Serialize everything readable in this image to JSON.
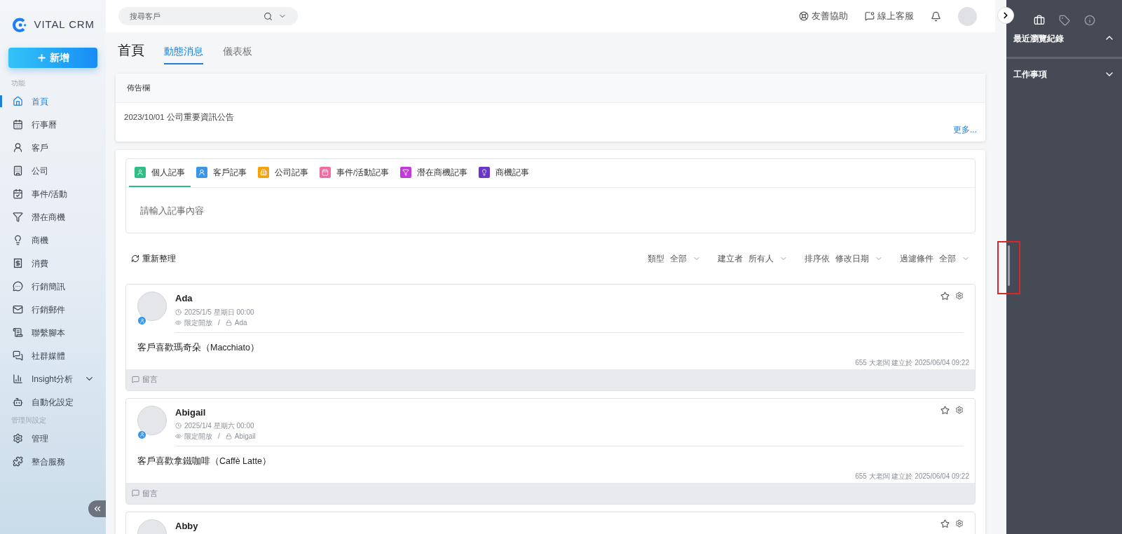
{
  "logo": {
    "text": "VITAL CRM"
  },
  "new_button": {
    "label": "新增"
  },
  "sidebar": {
    "sections": [
      {
        "title": "功能",
        "items": [
          {
            "label": "首頁",
            "selected": true,
            "kind": "link"
          },
          {
            "label": "行事曆",
            "selected": false,
            "kind": "link"
          },
          {
            "label": "客戶",
            "selected": false,
            "kind": "link"
          },
          {
            "label": "公司",
            "selected": false,
            "kind": "link"
          },
          {
            "label": "事件/活動",
            "selected": false,
            "kind": "link"
          },
          {
            "label": "潛在商機",
            "selected": false,
            "kind": "link"
          },
          {
            "label": "商機",
            "selected": false,
            "kind": "link"
          },
          {
            "label": "消費",
            "selected": false,
            "kind": "link"
          },
          {
            "label": "行銷簡訊",
            "selected": false,
            "kind": "link"
          },
          {
            "label": "行銷郵件",
            "selected": false,
            "kind": "link"
          },
          {
            "label": "聯繫腳本",
            "selected": false,
            "kind": "link"
          },
          {
            "label": "社群媒體",
            "selected": false,
            "kind": "link"
          },
          {
            "label": "Insight分析",
            "selected": false,
            "kind": "group",
            "expanded": false
          },
          {
            "label": "自動化設定",
            "selected": false,
            "kind": "link"
          }
        ]
      },
      {
        "title": "管理與設定",
        "items": [
          {
            "label": "管理",
            "selected": false,
            "kind": "link"
          },
          {
            "label": "整合服務",
            "selected": false,
            "kind": "link"
          }
        ]
      }
    ]
  },
  "topbar": {
    "search": {
      "placeholder": "搜尋客戶"
    },
    "links": [
      "友善協助",
      "線上客服"
    ]
  },
  "page": {
    "title": "首頁",
    "tabs": [
      {
        "label": "動態消息",
        "selected": true
      },
      {
        "label": "儀表板",
        "selected": false
      }
    ]
  },
  "bulletin": {
    "title": "佈告欄",
    "items": [
      "2023/10/01 公司重要資訊公告"
    ],
    "more": "更多..."
  },
  "composer": {
    "tabs": [
      {
        "label": "個人記事",
        "selected": true,
        "color": "#2ebd85"
      },
      {
        "label": "客戶記事",
        "selected": false,
        "color": "#3a97e8"
      },
      {
        "label": "公司記事",
        "selected": false,
        "color": "#f5a10d"
      },
      {
        "label": "事件/活動記事",
        "selected": false,
        "color": "#f06aa6"
      },
      {
        "label": "潛在商機記事",
        "selected": false,
        "color": "#c23ad9"
      },
      {
        "label": "商機記事",
        "selected": false,
        "color": "#6a35c9"
      }
    ],
    "placeholder": "請輸入記事內容"
  },
  "toolbar": {
    "refresh": "重新整理",
    "filters": [
      {
        "label": "類型",
        "value": "全部"
      },
      {
        "label": "建立者",
        "value": "所有人"
      },
      {
        "label": "排序依",
        "value": "修改日期"
      },
      {
        "label": "過濾條件",
        "value": "全部"
      }
    ]
  },
  "posts": [
    {
      "name": "Ada",
      "date": "2025/1/5 星期日 00:00",
      "visibility": "限定開放",
      "separator": "/",
      "owner": "Ada",
      "body": "客戶喜歡瑪奇朵（Macchiato）",
      "footer": "655 大老闆 建立於 2025/06/04 09:22",
      "comment": "留言",
      "starred": false
    },
    {
      "name": "Abigail",
      "date": "2025/1/4 星期六 00:00",
      "visibility": "限定開放",
      "separator": "/",
      "owner": "Abigail",
      "body": "客戶喜歡拿鐵咖啡（Caffè Latte）",
      "footer": "655 大老闆 建立於 2025/06/04 09:22",
      "comment": "留言",
      "starred": false
    },
    {
      "name": "Abby",
      "starred": false
    }
  ],
  "right_panel": {
    "tabs": [
      {
        "selected": true
      },
      {
        "selected": false
      },
      {
        "selected": false
      }
    ],
    "sections": [
      {
        "title": "最近瀏覽紀錄",
        "expanded": true
      },
      {
        "title": "工作事項",
        "expanded": false
      }
    ]
  }
}
